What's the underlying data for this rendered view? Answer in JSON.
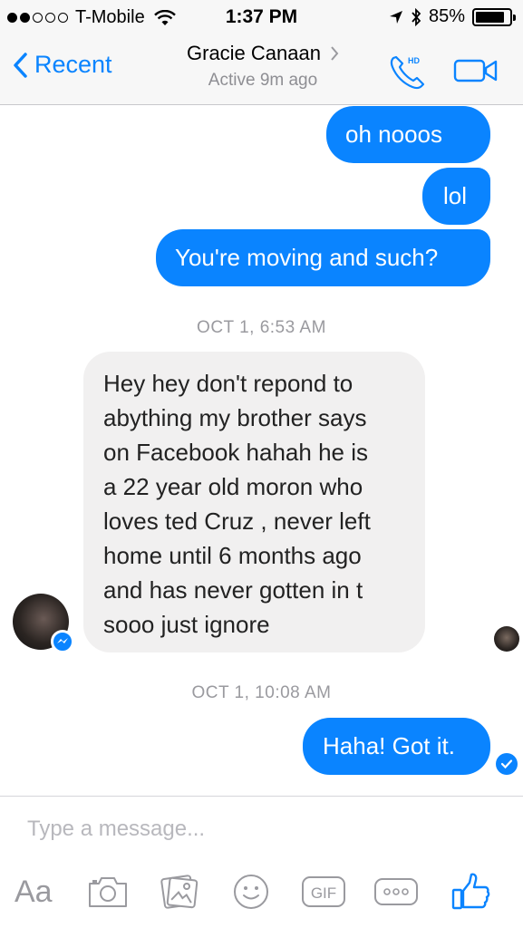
{
  "status_bar": {
    "carrier": "T-Mobile",
    "time": "1:37 PM",
    "battery": "85%",
    "battery_level": 0.85
  },
  "nav": {
    "back_label": "Recent",
    "contact_name": "Gracie Canaan",
    "contact_status": "Active 9m ago",
    "hd_label": "HD"
  },
  "messages": {
    "m1": "oh nooos",
    "m2": "lol",
    "m3": "You're moving and such?",
    "ts1": "OCT 1, 6:53 AM",
    "m4_lines": [
      "Hey hey don't repond to",
      "abything my brother says",
      "on Facebook hahah he is",
      "a 22 year old moron who",
      "loves ted Cruz , never left",
      "home until 6 months ago",
      "and has never gotten in t",
      "sooo just ignore"
    ],
    "ts2": "OCT 1, 10:08 AM",
    "m5": "Haha! Got it."
  },
  "composer": {
    "placeholder": "Type a message...",
    "aa_label": "Aa",
    "gif_label": "GIF"
  },
  "colors": {
    "accent": "#0a84ff",
    "incoming_bubble": "#f1f0f0",
    "icon_gray": "#9a9a9f"
  }
}
